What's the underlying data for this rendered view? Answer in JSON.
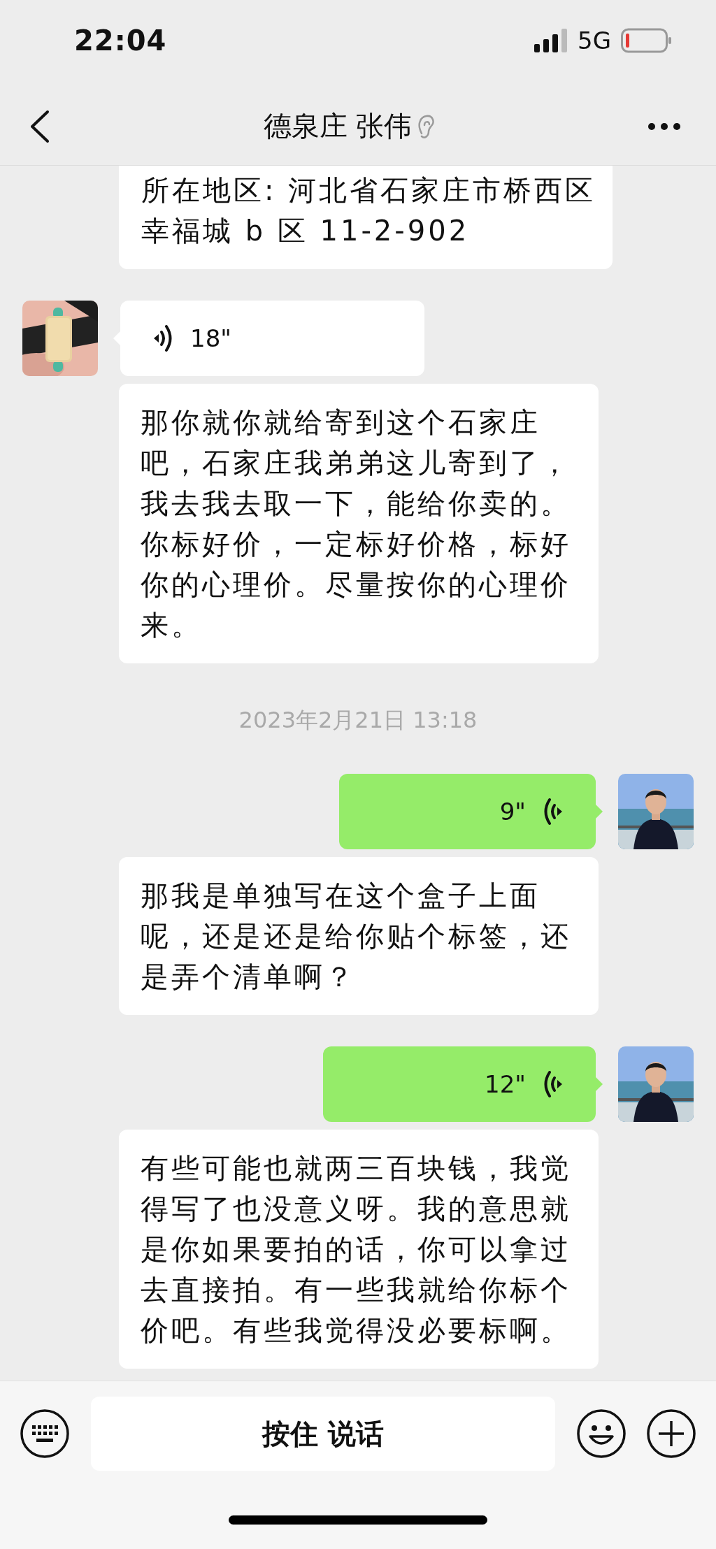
{
  "status_bar": {
    "time": "22:04",
    "network": "5G"
  },
  "header": {
    "title": "德泉庄 张伟",
    "earpiece_mode": true
  },
  "messages": [
    {
      "kind": "text",
      "outgoing": false,
      "continued": true,
      "text": "所在地区: 河北省石家庄市桥西区幸福城 b 区 11-2-902"
    },
    {
      "kind": "voice",
      "outgoing": false,
      "duration": "18\""
    },
    {
      "kind": "transcript",
      "text": "那你就你就给寄到这个石家庄吧，石家庄我弟弟这儿寄到了，我去我去取一下，能给你卖的。你标好价，一定标好价格，标好你的心理价。尽量按你的心理价来。"
    },
    {
      "kind": "time",
      "text": "2023年2月21日 13:18"
    },
    {
      "kind": "voice",
      "outgoing": true,
      "duration": "9\""
    },
    {
      "kind": "transcript",
      "text": "那我是单独写在这个盒子上面呢，还是还是给你贴个标签，还是弄个清单啊？"
    },
    {
      "kind": "voice",
      "outgoing": true,
      "duration": "12\""
    },
    {
      "kind": "transcript",
      "text": "有些可能也就两三百块钱，我觉得写了也没意义呀。我的意思就是你如果要拍的话，你可以拿过去直接拍。有一些我就给你标个价吧。有些我觉得没必要标啊。"
    }
  ],
  "input_bar": {
    "hold_to_talk": "按住 说话"
  }
}
